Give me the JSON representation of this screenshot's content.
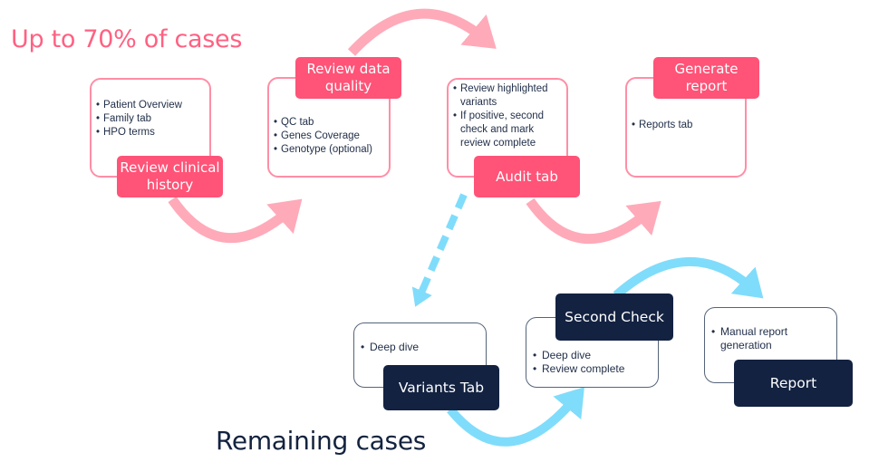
{
  "headings": {
    "top": "Up to 70% of cases",
    "bottom": "Remaining cases"
  },
  "colors": {
    "pink_accent": "#ff5377",
    "pink_heading": "#ff6182",
    "pink_border": "#ff8ea6",
    "pink_arrow": "#ffaab9",
    "navy": "#132241",
    "navy_border": "#55647a",
    "blue_arrow": "#80dcfb",
    "text_dark": "#22304a"
  },
  "top_flow": [
    {
      "label": "Review clinical history",
      "items": [
        "Patient Overview",
        "Family tab",
        "HPO terms"
      ]
    },
    {
      "label": "Review data quality",
      "items": [
        "QC tab",
        "Genes Coverage",
        "Genotype (optional)"
      ]
    },
    {
      "label": "Audit tab",
      "items": [
        "Review highlighted variants",
        "If positive, second check and mark review complete"
      ]
    },
    {
      "label": "Generate report",
      "items": [
        "Reports tab"
      ]
    }
  ],
  "bottom_flow": [
    {
      "label": "Variants Tab",
      "items": [
        "Deep dive"
      ]
    },
    {
      "label": "Second Check",
      "items": [
        "Deep dive",
        "Review complete"
      ]
    },
    {
      "label": "Report",
      "items": [
        "Manual report generation"
      ]
    }
  ]
}
